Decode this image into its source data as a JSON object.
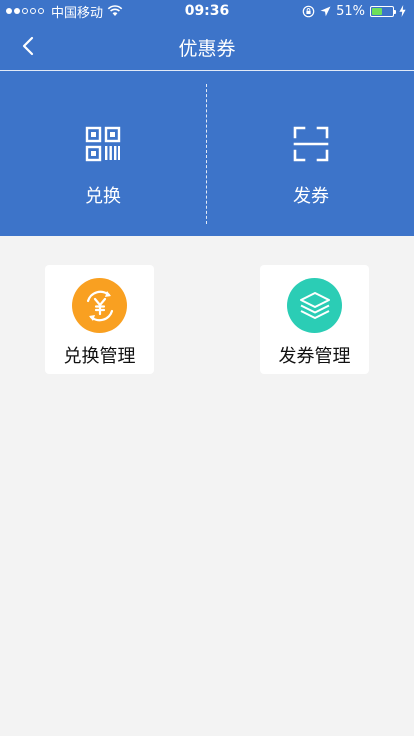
{
  "colors": {
    "brand": "#3d74c9",
    "page_bg": "#f3f3f3",
    "card_bg": "#ffffff",
    "exchange_mgmt_circle": "#f9a021",
    "issue_mgmt_circle": "#2bcdb5"
  },
  "status_bar": {
    "carrier": "中国移动",
    "time": "09:36",
    "battery_percent": "51%",
    "battery_level": 0.51,
    "signal_bars_filled": 2,
    "signal_bars_total": 5
  },
  "nav": {
    "title": "优惠券",
    "back_icon": "chevron-left-icon"
  },
  "actions": [
    {
      "label": "兑换",
      "icon": "qr-code-icon"
    },
    {
      "label": "发券",
      "icon": "scan-frame-icon"
    }
  ],
  "cards": [
    {
      "label": "兑换管理",
      "icon": "yen-exchange-icon"
    },
    {
      "label": "发券管理",
      "icon": "layers-icon"
    }
  ]
}
